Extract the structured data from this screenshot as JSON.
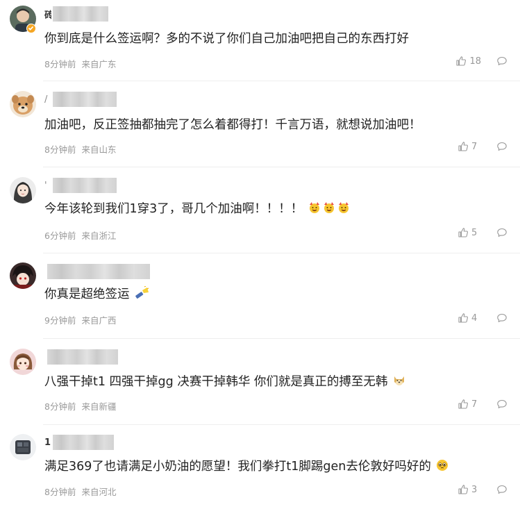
{
  "comments": [
    {
      "name_prefix": "砖",
      "verified": true,
      "text": "你到底是什么签运啊？多的不说了你们自己加油吧把自己的东西打好",
      "emojis": [],
      "time": "8分钟前",
      "location": "来自广东",
      "likes": "18"
    },
    {
      "name_prefix": "/",
      "verified": false,
      "text": "加油吧，反正签抽都抽完了怎么着都得打！千言万语，就想说加油吧！",
      "emojis": [],
      "time": "8分钟前",
      "location": "来自山东",
      "likes": "7"
    },
    {
      "name_prefix": "'",
      "verified": false,
      "text": "今年该轮到我们1穿3了，哥几个加油啊！！！！",
      "emojis": [
        "cheer-emoji",
        "cheer-emoji",
        "cheer-emoji"
      ],
      "time": "6分钟前",
      "location": "来自浙江",
      "likes": "5"
    },
    {
      "name_prefix": "",
      "verified": false,
      "text": "你真是超绝签运",
      "emojis": [
        "flashlight-emoji"
      ],
      "time": "9分钟前",
      "location": "来自广西",
      "likes": "4"
    },
    {
      "name_prefix": "",
      "verified": false,
      "text": "八强干掉t1 四强干掉gg 决赛干掉韩华 你们就是真正的搏至无韩",
      "emojis": [
        "doge-emoji"
      ],
      "time": "8分钟前",
      "location": "来自新疆",
      "likes": "7"
    },
    {
      "name_prefix": "1",
      "verified": false,
      "text": "满足369了也请满足小奶油的愿望！我们拳打t1脚踢gen去伦敦好吗好的",
      "emojis": [
        "pleading-emoji"
      ],
      "time": "8分钟前",
      "location": "来自河北",
      "likes": "3"
    }
  ],
  "colors": {
    "text": "#222222",
    "meta": "#999999",
    "divider": "#eeeeee",
    "verified_badge": "#f5a623"
  }
}
